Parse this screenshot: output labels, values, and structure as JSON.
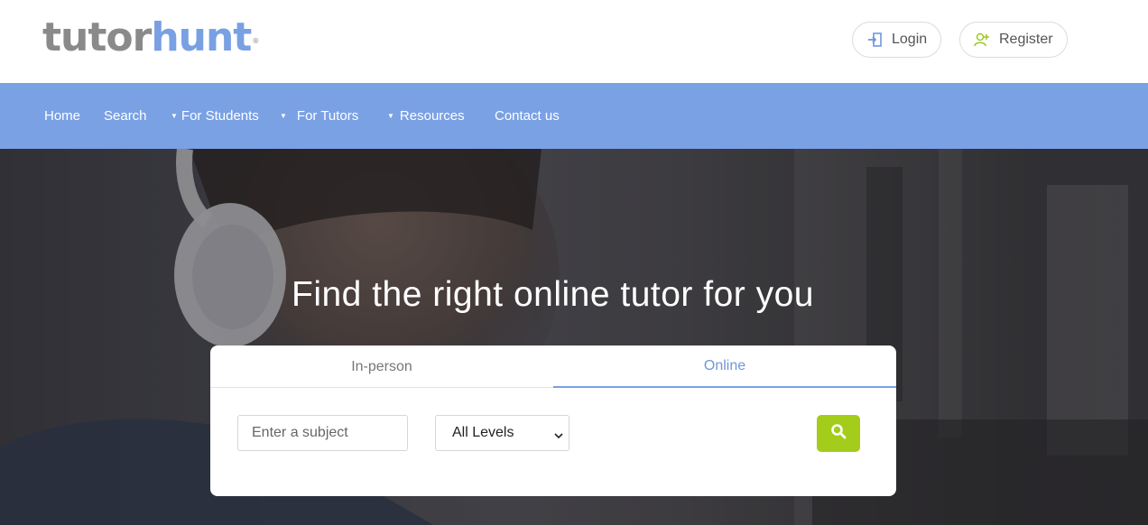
{
  "brand": {
    "logo_text_a": "tutor",
    "logo_text_b": "hunt",
    "registered_mark": "®",
    "color_gray": "#8a8a8a",
    "color_blue": "#78a0e3"
  },
  "header": {
    "login_label": "Login",
    "register_label": "Register",
    "login_icon": "login-arrow-icon",
    "register_icon": "add-user-icon"
  },
  "nav": {
    "background": "#7aa1e4",
    "items": [
      {
        "label": "Home",
        "dropdown": false
      },
      {
        "label": "Search",
        "dropdown": false
      },
      {
        "label": "For Students",
        "dropdown": true
      },
      {
        "label": "For Tutors",
        "dropdown": true
      },
      {
        "label": "Resources",
        "dropdown": true
      },
      {
        "label": "Contact us",
        "dropdown": false
      }
    ],
    "caret_glyph": "▼"
  },
  "hero": {
    "title": "Find the right online tutor for you"
  },
  "search_card": {
    "tabs": [
      {
        "label": "In-person",
        "active": false
      },
      {
        "label": "Online",
        "active": true
      }
    ],
    "subject_placeholder": "Enter a subject",
    "level_selected": "All Levels",
    "search_button_color": "#a4cc1b",
    "search_icon": "magnifier-icon"
  }
}
